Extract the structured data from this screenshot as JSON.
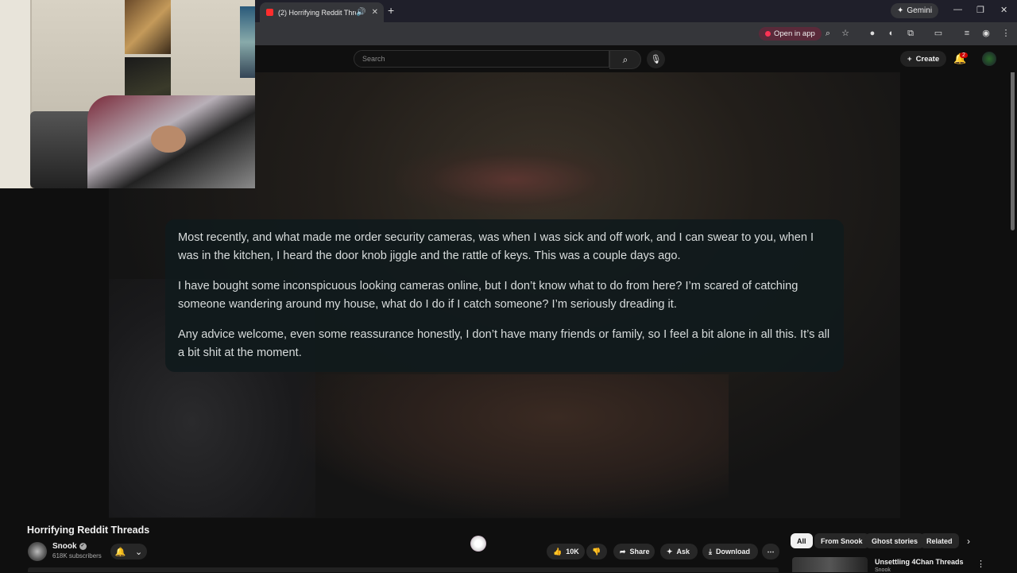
{
  "browser": {
    "tab_title": "(2) Horrifying Reddit Threads",
    "gemini_label": "Gemini",
    "open_in_app_label": "Open in app"
  },
  "header": {
    "search_placeholder": "Search",
    "create_label": "Create",
    "notification_count": "2"
  },
  "caption": {
    "paragraphs": [
      "Most recently, and what made me order security cameras, was when I was sick and off work, and I can swear to you, when I was in the kitchen, I heard the door knob jiggle and the rattle of keys. This was a couple days ago.",
      "I have bought some inconspicuous looking cameras online, but I don’t know what to do from here? I’m scared of catching someone wandering around my house, what do I do if I catch someone? I’m seriously dreading it.",
      "Any advice welcome, even some reassurance honestly, I don’t have many friends or family, so I feel a bit alone in all this. It’s all a bit shit at the moment."
    ]
  },
  "video": {
    "title": "Horrifying Reddit Threads",
    "channel_name": "Snook",
    "subscribers": "618K subscribers",
    "like_count": "10K",
    "share_label": "Share",
    "ask_label": "Ask",
    "download_label": "Download"
  },
  "chips": [
    "All",
    "From Snook",
    "Ghost stories",
    "Related"
  ],
  "related": {
    "title": "Unsettling 4Chan Threads",
    "channel": "Snook"
  }
}
